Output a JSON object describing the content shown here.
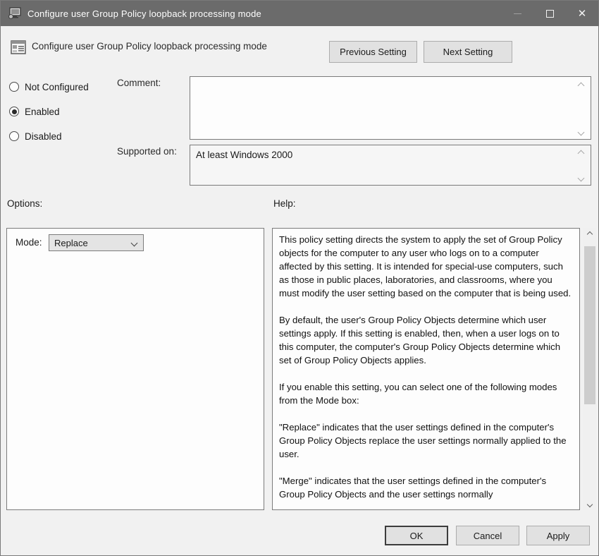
{
  "window": {
    "title": "Configure user Group Policy loopback processing mode"
  },
  "header": {
    "title": "Configure user Group Policy loopback processing mode",
    "previous_button": "Previous Setting",
    "next_button": "Next Setting"
  },
  "state": {
    "radios": [
      {
        "label": "Not Configured",
        "selected": false
      },
      {
        "label": "Enabled",
        "selected": true
      },
      {
        "label": "Disabled",
        "selected": false
      }
    ],
    "comment_label": "Comment:",
    "comment_value": "",
    "supported_label": "Supported on:",
    "supported_value": "At least Windows 2000"
  },
  "options": {
    "section_label": "Options:",
    "mode_label": "Mode:",
    "mode_value": "Replace"
  },
  "help": {
    "section_label": "Help:",
    "paragraphs": [
      "This policy setting directs the system to apply the set of Group Policy objects for the computer to any user who logs on to a computer affected by this setting. It is intended for special-use computers, such as those in public places, laboratories, and classrooms, where you must modify the user setting based on the computer that is being used.",
      "By default, the user's Group Policy Objects determine which user settings apply. If this setting is enabled, then, when a user logs on to this computer, the computer's Group Policy Objects determine which set of Group Policy Objects applies.",
      "If you enable this setting, you can select one of the following modes from the Mode box:",
      "\"Replace\" indicates that the user settings defined in the computer's Group Policy Objects replace the user settings normally applied to the user.",
      "\"Merge\" indicates that the user settings defined in the computer's Group Policy Objects and the user settings normally"
    ]
  },
  "footer": {
    "ok_label": "OK",
    "cancel_label": "Cancel",
    "apply_label": "Apply"
  },
  "icons": {
    "window_icon": "computer-monitor-icon",
    "header_icon": "policy-setting-icon",
    "minimize": "minimize-icon",
    "maximize": "maximize-icon",
    "close": "close-icon"
  },
  "colors": {
    "titlebar_bg": "#6b6b6b",
    "titlebar_text": "#ffffff",
    "body_bg": "#f1f1f1",
    "panel_bg": "#fdfdfd",
    "panel_border": "#7b7b7b",
    "button_bg": "#e1e1e1",
    "button_border": "#acacac",
    "scroll_thumb": "#cdcdcd"
  }
}
